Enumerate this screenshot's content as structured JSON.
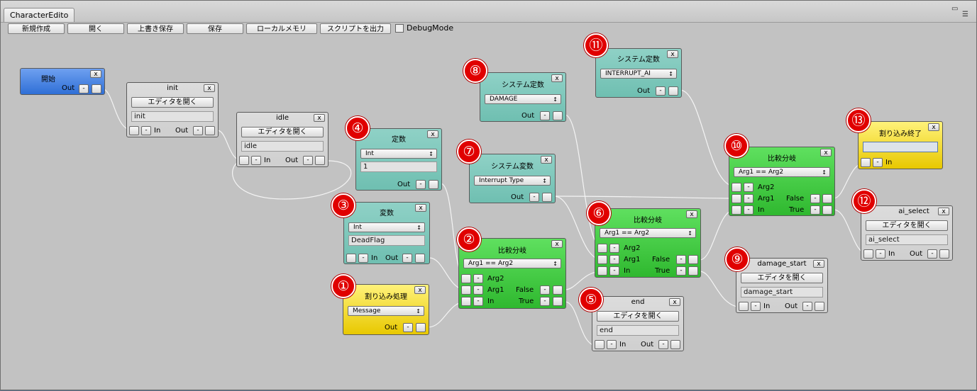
{
  "window": {
    "tab_title": "CharacterEdito"
  },
  "toolbar": {
    "new": "新規作成",
    "open": "開く",
    "overwrite_save": "上書き保存",
    "save": "保存",
    "local_memory": "ローカルメモリ",
    "export_script": "スクリプトを出力",
    "debug_mode": "DebugMode"
  },
  "nodes": {
    "start": {
      "title": "開始",
      "out": "Out"
    },
    "init": {
      "title": "init",
      "open": "エディタを開く",
      "value": "init",
      "in": "In",
      "out": "Out"
    },
    "idle": {
      "title": "idle",
      "open": "エディタを開く",
      "value": "idle",
      "in": "In",
      "out": "Out"
    },
    "const": {
      "title": "定数",
      "type": "Int",
      "value": "1",
      "out": "Out"
    },
    "var": {
      "title": "変数",
      "type": "Int",
      "value": "DeadFlag",
      "in": "In",
      "out": "Out"
    },
    "interrupt": {
      "title": "割り込み処理",
      "type": "Message",
      "out": "Out"
    },
    "sysvar": {
      "title": "システム変数",
      "type": "Interrupt Type",
      "out": "Out"
    },
    "sysconst8": {
      "title": "システム定数",
      "type": "DAMAGE",
      "out": "Out"
    },
    "cmp2": {
      "title": "比較分岐",
      "op": "Arg1 == Arg2",
      "arg2": "Arg2",
      "arg1": "Arg1",
      "in": "In",
      "false": "False",
      "true": "True"
    },
    "end": {
      "title": "end",
      "open": "エディタを開く",
      "value": "end",
      "in": "In",
      "out": "Out"
    },
    "cmp6": {
      "title": "比較分岐",
      "op": "Arg1 == Arg2",
      "arg2": "Arg2",
      "arg1": "Arg1",
      "in": "In",
      "false": "False",
      "true": "True"
    },
    "sysconst11": {
      "title": "システム定数",
      "type": "INTERRUPT_AI",
      "out": "Out"
    },
    "cmp10": {
      "title": "比較分岐",
      "op": "Arg1 == Arg2",
      "arg2": "Arg2",
      "arg1": "Arg1",
      "in": "In",
      "false": "False",
      "true": "True"
    },
    "damage": {
      "title": "damage_start",
      "open": "エディタを開く",
      "value": "damage_start",
      "in": "In",
      "out": "Out"
    },
    "interrupt_end": {
      "title": "割り込み終了",
      "value": "",
      "in": "In"
    },
    "ai_select": {
      "title": "ai_select",
      "open": "エディタを開く",
      "value": "ai_select",
      "in": "In",
      "out": "Out"
    }
  },
  "buttons": {
    "close": "x",
    "minus": "-"
  },
  "badges": [
    "①",
    "②",
    "③",
    "④",
    "⑤",
    "⑥",
    "⑦",
    "⑧",
    "⑨",
    "⑩",
    "⑪",
    "⑫",
    "⑬"
  ],
  "colors": {
    "blue": "#2f6fd6",
    "gray": "#d4d4d4",
    "teal": "#7cc8bb",
    "green": "#3cc43c",
    "yellow": "#f3dc20",
    "badge": "#e00000"
  }
}
